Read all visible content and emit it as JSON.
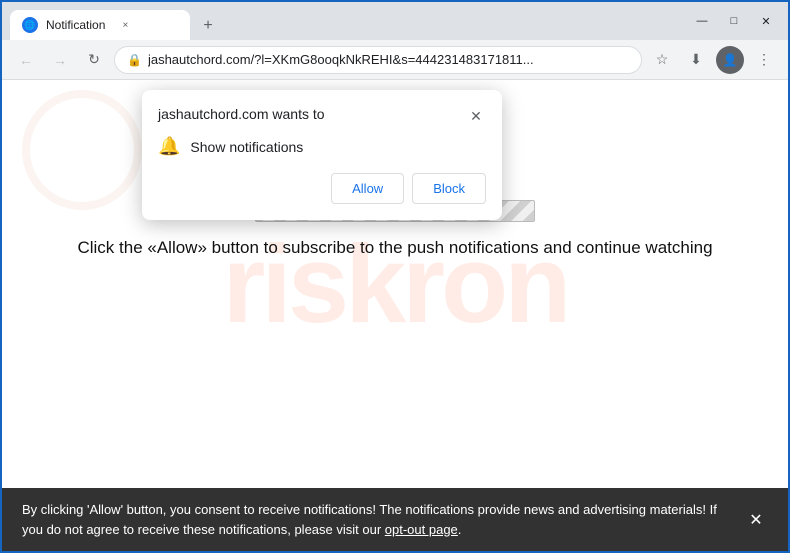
{
  "browser": {
    "tab_title": "Notification",
    "tab_close_label": "×",
    "new_tab_label": "+",
    "win_minimize": "—",
    "win_maximize": "□",
    "win_close": "✕"
  },
  "address_bar": {
    "url": "jashautchord.com/?l=XKmG8ooqkNkREHI&s=444231483171811...",
    "lock_icon": "🔒",
    "back_icon": "←",
    "forward_icon": "→",
    "reload_icon": "↻",
    "star_icon": "☆",
    "downloads_icon": "⬇",
    "menu_icon": "⋮"
  },
  "notification_popup": {
    "title": "jashautchord.com wants to",
    "close_label": "✕",
    "bell_icon": "🔔",
    "notification_label": "Show notifications",
    "allow_label": "Allow",
    "block_label": "Block"
  },
  "page": {
    "loading_bar_visible": true,
    "instruction_text": "Click the «Allow» button to subscribe to the push notifications and continue watching",
    "watermark_text": "riskron"
  },
  "consent_bar": {
    "text": "By clicking 'Allow' button, you consent to receive notifications! The notifications provide news and advertising materials! If you do not agree to receive these notifications, please visit our ",
    "link_text": "opt-out page",
    "link_suffix": ".",
    "close_label": "✕"
  }
}
